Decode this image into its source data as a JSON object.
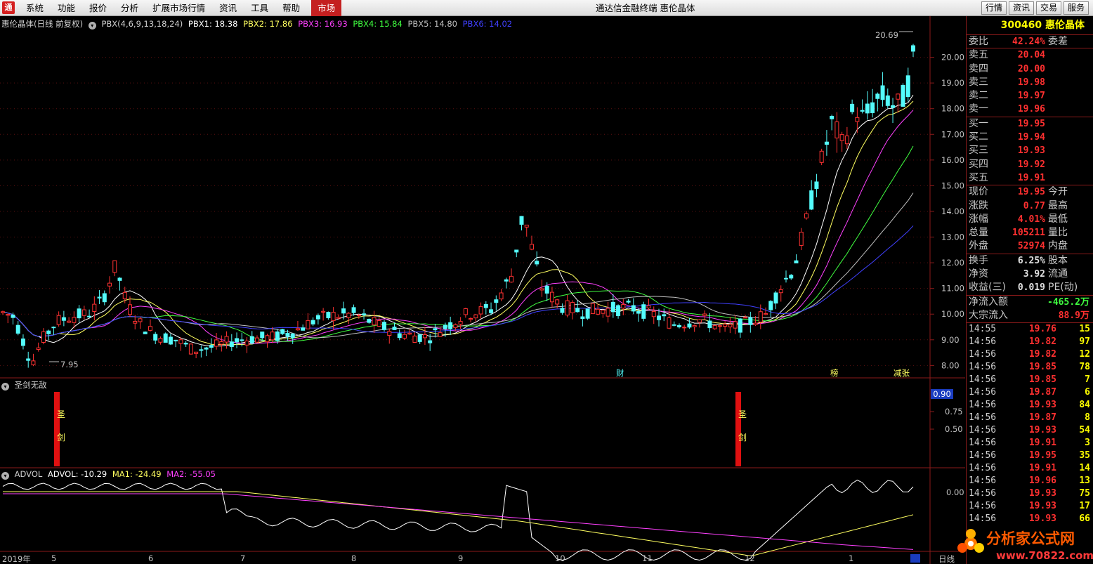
{
  "menu": {
    "logo": "通",
    "items": [
      "系统",
      "功能",
      "报价",
      "分析",
      "扩展市场行情",
      "资讯",
      "工具",
      "帮助"
    ],
    "active_item": "市场"
  },
  "window_title": "通达信金融终端  惠伦晶体",
  "right_buttons": [
    "行情",
    "资讯",
    "交易",
    "服务"
  ],
  "main_legend": {
    "title": "惠伦晶体(日线 前复权)",
    "indicator": "PBX(4,6,9,13,18,24)",
    "pbx1": "PBX1: 18.38",
    "pbx2": "PBX2: 17.86",
    "pbx3": "PBX3: 16.93",
    "pbx4": "PBX4: 15.84",
    "pbx5": "PBX5: 14.80",
    "pbx6": "PBX6: 14.02"
  },
  "colors": {
    "pbx1": "#ffffff",
    "pbx2": "#ffff60",
    "pbx3": "#ff40ff",
    "pbx4": "#40ff40",
    "pbx5": "#c0c0c0",
    "pbx6": "#4040ff",
    "up": "#ff3232",
    "down": "#54fcfc",
    "grid": "#8b1a1a"
  },
  "price_axis": [
    "20.00",
    "19.00",
    "18.00",
    "17.00",
    "16.00",
    "15.00",
    "14.00",
    "13.00",
    "12.00",
    "11.00",
    "10.00",
    "9.00",
    "8.00"
  ],
  "annotations": {
    "high": "20.69",
    "low": "7.95",
    "markers": [
      "财",
      "榜",
      "减张"
    ]
  },
  "sub1": {
    "title": "圣剑无敌",
    "axis": [
      "0.90",
      "0.75",
      "0.50"
    ],
    "signal_text": [
      "圣",
      "剑"
    ]
  },
  "sub2": {
    "legend_name": "ADVOL",
    "advol": "ADVOL: -10.29",
    "ma1": "MA1: -24.49",
    "ma2": "MA2: -55.05",
    "axis": [
      "0.00"
    ]
  },
  "time_axis": {
    "year_label": "2019年",
    "months": [
      "5",
      "6",
      "7",
      "8",
      "9",
      "10",
      "11",
      "12",
      "1"
    ],
    "period_button": "日线"
  },
  "quote": {
    "code": "300460",
    "name": "惠伦晶体",
    "weibi": {
      "label": "委比",
      "value": "42.24%",
      "label2": "委差"
    },
    "sells": [
      {
        "label": "卖五",
        "price": "20.04"
      },
      {
        "label": "卖四",
        "price": "20.00"
      },
      {
        "label": "卖三",
        "price": "19.98"
      },
      {
        "label": "卖二",
        "price": "19.97"
      },
      {
        "label": "卖一",
        "price": "19.96"
      }
    ],
    "buys": [
      {
        "label": "买一",
        "price": "19.95"
      },
      {
        "label": "买二",
        "price": "19.94"
      },
      {
        "label": "买三",
        "price": "19.93"
      },
      {
        "label": "买四",
        "price": "19.92"
      },
      {
        "label": "买五",
        "price": "19.91"
      }
    ],
    "stats1": [
      {
        "label": "现价",
        "value": "19.95",
        "label2": "今开"
      },
      {
        "label": "涨跌",
        "value": "0.77",
        "label2": "最高"
      },
      {
        "label": "涨幅",
        "value": "4.01%",
        "label2": "最低"
      },
      {
        "label": "总量",
        "value": "105211",
        "label2": "量比"
      },
      {
        "label": "外盘",
        "value": "52974",
        "label2": "内盘"
      }
    ],
    "stats2": [
      {
        "label": "换手",
        "value": "6.25%",
        "label2": "股本"
      },
      {
        "label": "净资",
        "value": "3.92",
        "label2": "流通"
      },
      {
        "label": "收益(三)",
        "value": "0.019",
        "label2": "PE(动)"
      }
    ],
    "flows": [
      {
        "label": "净流入额",
        "value": "-465.2万"
      },
      {
        "label": "大宗流入",
        "value": "88.9万"
      }
    ],
    "ticks": [
      {
        "time": "14:55",
        "price": "19.76",
        "vol": "15"
      },
      {
        "time": "14:56",
        "price": "19.82",
        "vol": "97"
      },
      {
        "time": "14:56",
        "price": "19.82",
        "vol": "12"
      },
      {
        "time": "14:56",
        "price": "19.85",
        "vol": "78"
      },
      {
        "time": "14:56",
        "price": "19.85",
        "vol": "7"
      },
      {
        "time": "14:56",
        "price": "19.87",
        "vol": "6"
      },
      {
        "time": "14:56",
        "price": "19.93",
        "vol": "84"
      },
      {
        "time": "14:56",
        "price": "19.87",
        "vol": "8"
      },
      {
        "time": "14:56",
        "price": "19.93",
        "vol": "54"
      },
      {
        "time": "14:56",
        "price": "19.91",
        "vol": "3"
      },
      {
        "time": "14:56",
        "price": "19.95",
        "vol": "35"
      },
      {
        "time": "14:56",
        "price": "19.91",
        "vol": "14"
      },
      {
        "time": "14:56",
        "price": "19.96",
        "vol": "13"
      },
      {
        "time": "14:56",
        "price": "19.93",
        "vol": "75"
      },
      {
        "time": "14:56",
        "price": "19.93",
        "vol": "17"
      },
      {
        "time": "14:56",
        "price": "19.93",
        "vol": "66"
      }
    ]
  },
  "watermark": {
    "text": "分析家公式网",
    "url": "www.70822.com"
  }
}
